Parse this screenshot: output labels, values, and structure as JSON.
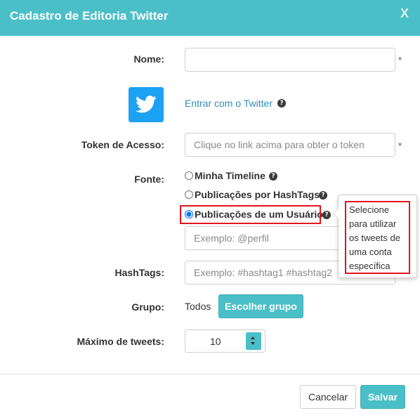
{
  "header": {
    "title": "Cadastro de Editoria Twitter",
    "close_label": "X"
  },
  "form": {
    "nome": {
      "label": "Nome:",
      "value": "",
      "placeholder": "",
      "required_mark": "*"
    },
    "twitter": {
      "link_text": "Entrar com o Twitter",
      "icon": "twitter-bird-icon"
    },
    "token": {
      "label": "Token de Acesso:",
      "value": "",
      "placeholder": "Clique no link acima para obter o token",
      "required_mark": "*"
    },
    "fonte": {
      "label": "Fonte:",
      "options": [
        {
          "label": "Minha Timeline",
          "selected": false
        },
        {
          "label": "Publicações por HashTags",
          "selected": false
        },
        {
          "label": "Publicações de um Usuário",
          "selected": true
        }
      ],
      "user_placeholder": "Exemplo: @perfil",
      "tooltip": "Selecione para utilizar os tweets de uma conta específica"
    },
    "hashtags": {
      "label": "HashTags:",
      "placeholder": "Exemplo: #hashtag1 #hashtag2"
    },
    "grupo": {
      "label": "Grupo:",
      "value": "Todos",
      "button_label": "Escolher grupo"
    },
    "max_tweets": {
      "label": "Máximo de tweets:",
      "value": "10"
    }
  },
  "footer": {
    "cancel_label": "Cancelar",
    "save_label": "Salvar"
  },
  "colors": {
    "header": "#4bbfc7",
    "accent": "#4bbfc7",
    "twitter": "#1da1f2",
    "highlight": "#e0141e",
    "link": "#2f8fb8"
  }
}
